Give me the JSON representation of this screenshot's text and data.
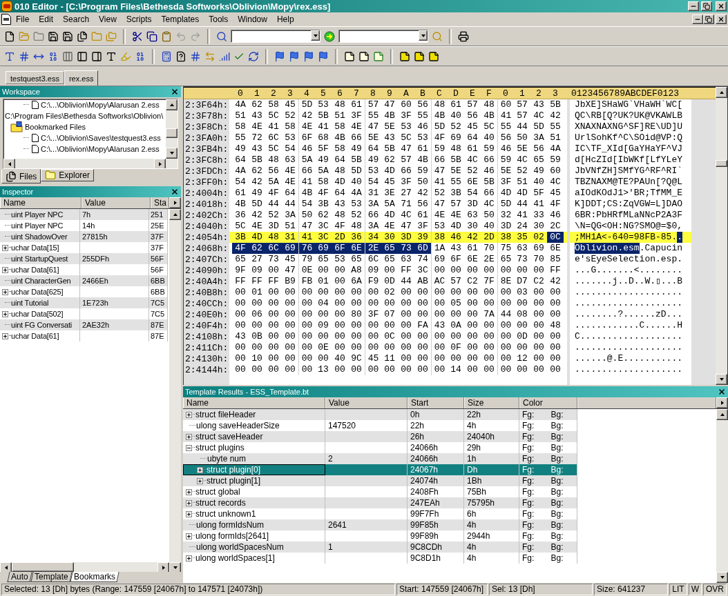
{
  "window": {
    "title": "010 Editor - [C:\\Program Files\\Bethesda Softworks\\Oblivion\\Mopy\\rex.ess]"
  },
  "menu": [
    "File",
    "Edit",
    "Search",
    "View",
    "Scripts",
    "Templates",
    "Tools",
    "Window",
    "Help"
  ],
  "file_tabs": [
    {
      "label": "testquest3.ess",
      "selected": false
    },
    {
      "label": "rex.ess",
      "selected": true
    }
  ],
  "workspace": {
    "title": "Workspace",
    "tree": [
      {
        "kind": "file",
        "label": "C:\\...\\Oblivion\\Mopy\\Alarusan 2.ess"
      },
      {
        "kind": "path",
        "label": "C:\\Program Files\\Bethesda Softworks\\Oblivion\\"
      },
      {
        "kind": "folder",
        "label": "Bookmarked Files",
        "children": [
          {
            "kind": "file",
            "label": "C:\\...\\Oblivion\\Saves\\testquest3.ess"
          },
          {
            "kind": "file",
            "label": "C:\\...\\Oblivion\\Mopy\\Alarusan 2.ess"
          }
        ]
      }
    ],
    "tabs": [
      {
        "label": "Files",
        "selected": true
      },
      {
        "label": "Explorer",
        "selected": false
      }
    ]
  },
  "inspector": {
    "title": "Inspector",
    "columns": [
      "Name",
      "Value",
      "Sta"
    ],
    "rows": [
      {
        "name": "uint Player NPC",
        "value": "7h",
        "start": "251",
        "expandable": false
      },
      {
        "name": "uint Player NPC",
        "value": "14h",
        "start": "25E",
        "expandable": false
      },
      {
        "name": "uint ShadowOver",
        "value": "27815h",
        "start": "37F",
        "expandable": false
      },
      {
        "name": "uchar Data[15]",
        "start": "37F",
        "expandable": true
      },
      {
        "name": "uint StartupQuest",
        "value": "255DFh",
        "start": "56F",
        "expandable": false
      },
      {
        "name": "uchar Data[61]",
        "start": "56F",
        "expandable": true
      },
      {
        "name": "uint CharacterGen",
        "value": "2466Eh",
        "start": "6BB",
        "expandable": false
      },
      {
        "name": "uchar Data[625]",
        "start": "6BB",
        "expandable": true
      },
      {
        "name": "uint Tutorial",
        "value": "1E723h",
        "start": "7C5",
        "expandable": false
      },
      {
        "name": "uchar Data[502]",
        "start": "7C5",
        "expandable": true
      },
      {
        "name": "uint FG Conversati",
        "value": "2AE32h",
        "start": "87E",
        "expandable": false
      },
      {
        "name": "uchar Data[61]",
        "start": "87E",
        "expandable": true
      }
    ]
  },
  "left_tabs": [
    {
      "label": "Auto",
      "selected": false
    },
    {
      "label": "Template",
      "selected": false
    },
    {
      "label": "Bookmarks",
      "selected": true
    }
  ],
  "hex": {
    "columns": [
      "0",
      "1",
      "2",
      "3",
      "4",
      "5",
      "6",
      "7",
      "8",
      "9",
      "A",
      "B",
      "C",
      "D",
      "E",
      "F",
      "0",
      "1",
      "2",
      "3"
    ],
    "ascii_header": "0123456789ABCDEF0123",
    "rows": [
      {
        "address": "2:3F64h:",
        "highlighted": false,
        "byte_runs": [
          {
            "selected": false,
            "bytes": [
              "4A",
              "62",
              "58",
              "45",
              "5D",
              "53",
              "48",
              "61",
              "57",
              "47",
              "60",
              "56",
              "48",
              "61",
              "57",
              "48",
              "60",
              "57",
              "43",
              "5B"
            ]
          }
        ],
        "ascii_runs": [
          {
            "selected": false,
            "text": "JbXE]SHaWG`VHaWH`WC["
          }
        ]
      },
      {
        "address": "2:3F78h:",
        "highlighted": false,
        "byte_runs": [
          {
            "selected": false,
            "bytes": [
              "51",
              "43",
              "5C",
              "52",
              "42",
              "5B",
              "51",
              "3F",
              "55",
              "4B",
              "3F",
              "55",
              "4B",
              "40",
              "56",
              "4B",
              "41",
              "57",
              "4C",
              "42"
            ]
          }
        ],
        "ascii_runs": [
          {
            "selected": false,
            "text": "QC\\RB[Q?UK?UK@VKAWLB"
          }
        ]
      },
      {
        "address": "2:3F8Ch:",
        "highlighted": false,
        "byte_runs": [
          {
            "selected": false,
            "bytes": [
              "58",
              "4E",
              "41",
              "58",
              "4E",
              "41",
              "58",
              "4E",
              "47",
              "5E",
              "53",
              "46",
              "5D",
              "52",
              "45",
              "5C",
              "55",
              "44",
              "5D",
              "55"
            ]
          }
        ],
        "ascii_runs": [
          {
            "selected": false,
            "text": "XNAXNAXNG^SF]RE\\UD]U"
          }
        ]
      },
      {
        "address": "2:3FA0h:",
        "highlighted": false,
        "byte_runs": [
          {
            "selected": false,
            "bytes": [
              "55",
              "72",
              "6C",
              "53",
              "6F",
              "68",
              "4B",
              "66",
              "5E",
              "43",
              "5C",
              "53",
              "4F",
              "69",
              "64",
              "40",
              "56",
              "50",
              "3A",
              "51"
            ]
          }
        ],
        "ascii_runs": [
          {
            "selected": false,
            "text": "UrlSohKf^C\\SOid@VP:Q"
          }
        ]
      },
      {
        "address": "2:3FB4h:",
        "highlighted": false,
        "byte_runs": [
          {
            "selected": false,
            "bytes": [
              "49",
              "43",
              "5C",
              "54",
              "46",
              "5F",
              "58",
              "49",
              "64",
              "5B",
              "47",
              "61",
              "59",
              "48",
              "61",
              "59",
              "46",
              "5E",
              "56",
              "4A"
            ]
          }
        ],
        "ascii_runs": [
          {
            "selected": false,
            "text": "IC\\TF_XId[GaYHaYF^VJ"
          }
        ]
      },
      {
        "address": "2:3FC8h:",
        "highlighted": false,
        "byte_runs": [
          {
            "selected": false,
            "bytes": [
              "64",
              "5B",
              "48",
              "63",
              "5A",
              "49",
              "64",
              "5B",
              "49",
              "62",
              "57",
              "4B",
              "66",
              "5B",
              "4C",
              "66",
              "59",
              "4C",
              "65",
              "59"
            ]
          }
        ],
        "ascii_runs": [
          {
            "selected": false,
            "text": "d[HcZId[IbWKf[LfYLeY"
          }
        ]
      },
      {
        "address": "2:3FDCh:",
        "highlighted": false,
        "byte_runs": [
          {
            "selected": false,
            "bytes": [
              "4A",
              "62",
              "56",
              "4E",
              "66",
              "5A",
              "48",
              "5D",
              "53",
              "4D",
              "66",
              "59",
              "47",
              "5E",
              "52",
              "46",
              "5E",
              "52",
              "49",
              "60"
            ]
          }
        ],
        "ascii_runs": [
          {
            "selected": false,
            "text": "JbVNfZH]SMfYG^RF^RI`"
          }
        ]
      },
      {
        "address": "2:3FF0h:",
        "highlighted": false,
        "byte_runs": [
          {
            "selected": false,
            "bytes": [
              "54",
              "42",
              "5A",
              "4E",
              "41",
              "58",
              "4D",
              "40",
              "54",
              "45",
              "3F",
              "50",
              "41",
              "55",
              "6E",
              "5B",
              "3F",
              "51",
              "40",
              "4C"
            ]
          }
        ],
        "ascii_runs": [
          {
            "selected": false,
            "text": "TBZNAXM@TE?PAUn[?Q@L"
          }
        ]
      },
      {
        "address": "2:4004h:",
        "highlighted": false,
        "byte_runs": [
          {
            "selected": false,
            "bytes": [
              "61",
              "49",
              "4F",
              "64",
              "4B",
              "4F",
              "64",
              "4A",
              "31",
              "3E",
              "27",
              "42",
              "52",
              "3B",
              "54",
              "66",
              "4D",
              "4D",
              "5F",
              "45"
            ]
          }
        ],
        "ascii_runs": [
          {
            "selected": false,
            "text": "aIOdKOdJ1>'BR;TfMM_E"
          }
        ]
      },
      {
        "address": "2:4018h:",
        "highlighted": false,
        "byte_runs": [
          {
            "selected": false,
            "bytes": [
              "4B",
              "5D",
              "44",
              "44",
              "54",
              "3B",
              "43",
              "53",
              "3A",
              "5A",
              "71",
              "56",
              "47",
              "57",
              "3D",
              "4C",
              "5D",
              "44",
              "41",
              "4F"
            ]
          }
        ],
        "ascii_runs": [
          {
            "selected": false,
            "text": "K]DDT;CS:ZqVGW=L]DAO"
          }
        ]
      },
      {
        "address": "2:402Ch:",
        "highlighted": false,
        "byte_runs": [
          {
            "selected": false,
            "bytes": [
              "36",
              "42",
              "52",
              "3A",
              "50",
              "62",
              "48",
              "52",
              "66",
              "4D",
              "4C",
              "61",
              "4E",
              "4E",
              "63",
              "50",
              "32",
              "41",
              "33",
              "46"
            ]
          }
        ],
        "ascii_runs": [
          {
            "selected": false,
            "text": "6BR:PbHRfMLaNNcP2A3F"
          }
        ]
      },
      {
        "address": "2:4040h:",
        "highlighted": false,
        "byte_runs": [
          {
            "selected": false,
            "bytes": [
              "5C",
              "4E",
              "3D",
              "51",
              "47",
              "3C",
              "4F",
              "48",
              "3A",
              "4E",
              "47",
              "3F",
              "53",
              "4D",
              "30",
              "40",
              "3D",
              "24",
              "30",
              "2C"
            ]
          }
        ],
        "ascii_runs": [
          {
            "selected": false,
            "text": "\\N=QG<OH:NG?SMO@=$0,"
          }
        ]
      },
      {
        "address": "2:4054h:",
        "highlighted": true,
        "byte_runs": [
          {
            "selected": false,
            "bytes": [
              "3B",
              "4D",
              "48",
              "31",
              "41",
              "3C",
              "2D",
              "36",
              "34",
              "30",
              "3D",
              "39",
              "38",
              "46",
              "42",
              "2D",
              "38",
              "35",
              "02"
            ]
          },
          {
            "selected": true,
            "bytes": [
              "0C"
            ]
          }
        ],
        "ascii_runs": [
          {
            "selected": false,
            "text": ";MH1A<-640=98FB-85."
          },
          {
            "selected": true,
            "text": "."
          }
        ]
      },
      {
        "address": "2:4068h:",
        "highlighted": false,
        "byte_runs": [
          {
            "selected": true,
            "bytes": [
              "4F",
              "62",
              "6C",
              "69",
              "76",
              "69",
              "6F",
              "6E",
              "2E",
              "65",
              "73",
              "6D"
            ]
          },
          {
            "selected": false,
            "bytes": [
              "1A",
              "43",
              "61",
              "70",
              "75",
              "63",
              "69",
              "6E"
            ]
          }
        ],
        "ascii_runs": [
          {
            "selected": true,
            "text": "Oblivion.esm"
          },
          {
            "selected": false,
            "text": ".Capucin"
          }
        ]
      },
      {
        "address": "2:407Ch:",
        "highlighted": false,
        "byte_runs": [
          {
            "selected": false,
            "bytes": [
              "65",
              "27",
              "73",
              "45",
              "79",
              "65",
              "53",
              "65",
              "6C",
              "65",
              "63",
              "74",
              "69",
              "6F",
              "6E",
              "2E",
              "65",
              "73",
              "70",
              "85"
            ]
          }
        ],
        "ascii_runs": [
          {
            "selected": false,
            "text": "e'sEyeSelection.esp."
          }
        ]
      },
      {
        "address": "2:4090h:",
        "highlighted": false,
        "byte_runs": [
          {
            "selected": false,
            "bytes": [
              "9F",
              "09",
              "00",
              "47",
              "0E",
              "00",
              "00",
              "A8",
              "09",
              "00",
              "FF",
              "3C",
              "00",
              "00",
              "00",
              "00",
              "00",
              "00",
              "00",
              "FF"
            ]
          }
        ],
        "ascii_runs": [
          {
            "selected": false,
            "text": "...G.......<........"
          }
        ]
      },
      {
        "address": "2:40A4h:",
        "highlighted": false,
        "byte_runs": [
          {
            "selected": false,
            "bytes": [
              "FF",
              "FF",
              "FF",
              "B9",
              "FB",
              "01",
              "00",
              "6A",
              "F9",
              "0D",
              "44",
              "AB",
              "AC",
              "57",
              "C2",
              "7F",
              "8E",
              "D7",
              "C2",
              "42"
            ]
          }
        ],
        "ascii_runs": [
          {
            "selected": false,
            "text": ".......j..D..W.▯...B"
          }
        ]
      },
      {
        "address": "2:40B8h:",
        "highlighted": false,
        "byte_runs": [
          {
            "selected": false,
            "bytes": [
              "00",
              "01",
              "00",
              "00",
              "00",
              "00",
              "00",
              "00",
              "00",
              "02",
              "00",
              "00",
              "00",
              "00",
              "00",
              "00",
              "00",
              "03",
              "00",
              "00"
            ]
          }
        ],
        "ascii_runs": [
          {
            "selected": false,
            "text": "...................."
          }
        ]
      },
      {
        "address": "2:40CCh:",
        "highlighted": false,
        "byte_runs": [
          {
            "selected": false,
            "bytes": [
              "00",
              "00",
              "00",
              "00",
              "00",
              "04",
              "00",
              "00",
              "00",
              "00",
              "00",
              "00",
              "00",
              "05",
              "00",
              "00",
              "00",
              "00",
              "00",
              "00"
            ]
          }
        ],
        "ascii_runs": [
          {
            "selected": false,
            "text": "...................."
          }
        ]
      },
      {
        "address": "2:40E0h:",
        "highlighted": false,
        "byte_runs": [
          {
            "selected": false,
            "bytes": [
              "00",
              "06",
              "00",
              "00",
              "00",
              "00",
              "00",
              "80",
              "3F",
              "07",
              "00",
              "00",
              "00",
              "00",
              "00",
              "7A",
              "44",
              "08",
              "00",
              "00"
            ]
          }
        ],
        "ascii_runs": [
          {
            "selected": false,
            "text": "........?......zD..."
          }
        ]
      },
      {
        "address": "2:40F4h:",
        "highlighted": false,
        "byte_runs": [
          {
            "selected": false,
            "bytes": [
              "00",
              "00",
              "00",
              "00",
              "00",
              "09",
              "00",
              "00",
              "00",
              "00",
              "00",
              "FA",
              "43",
              "0A",
              "00",
              "00",
              "00",
              "00",
              "00",
              "48"
            ]
          }
        ],
        "ascii_runs": [
          {
            "selected": false,
            "text": "............C......H"
          }
        ]
      },
      {
        "address": "2:4108h:",
        "highlighted": false,
        "byte_runs": [
          {
            "selected": false,
            "bytes": [
              "43",
              "0B",
              "00",
              "00",
              "00",
              "00",
              "00",
              "00",
              "00",
              "0C",
              "00",
              "00",
              "00",
              "00",
              "00",
              "00",
              "00",
              "0D",
              "00",
              "00"
            ]
          }
        ],
        "ascii_runs": [
          {
            "selected": false,
            "text": "C..................."
          }
        ]
      },
      {
        "address": "2:411Ch:",
        "highlighted": false,
        "byte_runs": [
          {
            "selected": false,
            "bytes": [
              "00",
              "00",
              "00",
              "00",
              "00",
              "0E",
              "00",
              "00",
              "00",
              "00",
              "00",
              "00",
              "00",
              "0F",
              "00",
              "00",
              "00",
              "00",
              "00",
              "00"
            ]
          }
        ],
        "ascii_runs": [
          {
            "selected": false,
            "text": "...................."
          }
        ]
      },
      {
        "address": "2:4130h:",
        "highlighted": false,
        "byte_runs": [
          {
            "selected": false,
            "bytes": [
              "00",
              "10",
              "00",
              "00",
              "00",
              "00",
              "40",
              "9C",
              "45",
              "11",
              "00",
              "00",
              "00",
              "00",
              "00",
              "00",
              "00",
              "12",
              "00",
              "00"
            ]
          }
        ],
        "ascii_runs": [
          {
            "selected": false,
            "text": "......@.E..........."
          }
        ]
      },
      {
        "address": "2:4144h:",
        "highlighted": false,
        "byte_runs": [
          {
            "selected": false,
            "bytes": [
              "00",
              "00",
              "00",
              "00",
              "00",
              "13",
              "00",
              "00",
              "00",
              "00",
              "00",
              "00",
              "00",
              "14",
              "00",
              "00",
              "00",
              "00",
              "00",
              "00"
            ]
          }
        ],
        "ascii_runs": [
          {
            "selected": false,
            "text": "...................."
          }
        ]
      }
    ]
  },
  "template_results": {
    "title": "Template Results - ESS_Template.bt",
    "columns": [
      "Name",
      "Value",
      "Start",
      "Size",
      "Color"
    ],
    "rows": [
      {
        "name": "struct fileHeader",
        "start": "0h",
        "size": "22h",
        "fg": "Fg:",
        "bg": "Bg:",
        "kind": "group",
        "expanded": false,
        "selected": false
      },
      {
        "name": "ulong saveHeaderSize",
        "value": "147520",
        "start": "22h",
        "size": "4h",
        "fg": "Fg:",
        "bg": "Bg:",
        "kind": "leaf",
        "selected": false
      },
      {
        "name": "struct saveHeader",
        "start": "26h",
        "size": "24040h",
        "fg": "Fg:",
        "bg": "Bg:",
        "kind": "group",
        "expanded": false,
        "selected": false
      },
      {
        "name": "struct plugins",
        "start": "24066h",
        "size": "29h",
        "fg": "Fg:",
        "bg": "Bg:",
        "kind": "group",
        "expanded": true,
        "selected": false,
        "children": [
          {
            "name": "ubyte num",
            "value": "2",
            "start": "24066h",
            "size": "1h",
            "fg": "Fg:",
            "bg": "Bg:",
            "kind": "leaf",
            "selected": false
          },
          {
            "name": "struct plugin[0]",
            "start": "24067h",
            "size": "Dh",
            "fg": "Fg:",
            "bg": "Bg:",
            "kind": "group",
            "expanded": false,
            "selected": true
          },
          {
            "name": "struct plugin[1]",
            "start": "24074h",
            "size": "1Bh",
            "fg": "Fg:",
            "bg": "Bg:",
            "kind": "group",
            "expanded": false,
            "selected": false
          }
        ]
      },
      {
        "name": "struct global",
        "start": "2408Fh",
        "size": "75Bh",
        "fg": "Fg:",
        "bg": "Bg:",
        "kind": "group",
        "expanded": false,
        "selected": false
      },
      {
        "name": "struct records",
        "start": "247EAh",
        "size": "75795h",
        "fg": "Fg:",
        "bg": "Bg:",
        "kind": "group",
        "expanded": false,
        "selected": false
      },
      {
        "name": "struct unknown1",
        "start": "99F7Fh",
        "size": "6h",
        "fg": "Fg:",
        "bg": "Bg:",
        "kind": "group",
        "expanded": false,
        "selected": false
      },
      {
        "name": "ulong formIdsNum",
        "value": "2641",
        "start": "99F85h",
        "size": "4h",
        "fg": "Fg:",
        "bg": "Bg:",
        "kind": "leaf",
        "selected": false
      },
      {
        "name": "ulong formIds[2641]",
        "start": "99F89h",
        "size": "2944h",
        "fg": "Fg:",
        "bg": "Bg:",
        "kind": "group",
        "expanded": false,
        "selected": false
      },
      {
        "name": "ulong worldSpacesNum",
        "value": "1",
        "start": "9C8CDh",
        "size": "4h",
        "fg": "Fg:",
        "bg": "Bg:",
        "kind": "leaf",
        "selected": false
      },
      {
        "name": "ulong worldSpaces[1]",
        "start": "9C8D1h",
        "size": "4h",
        "fg": "Fg:",
        "bg": "Bg:",
        "kind": "group",
        "expanded": false,
        "selected": false
      }
    ]
  },
  "status_bar": {
    "selection": "Selected: 13 [Dh] bytes (Range: 147559 [24067h] to 147571 [24073h])",
    "start": "Start: 147559 [24067h]",
    "sel": "Sel: 13 [Dh]",
    "size": "Size: 641237",
    "modes": [
      "LIT",
      "W",
      "OVR"
    ]
  }
}
